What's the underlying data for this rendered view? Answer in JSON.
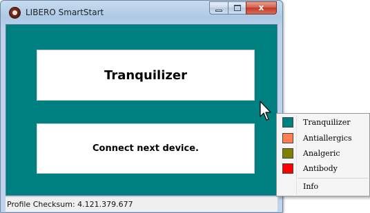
{
  "window": {
    "title": "LIBERO SmartStart",
    "icon": "libero-app-icon",
    "controls": {
      "minimize_icon": "minimize-icon",
      "maximize_icon": "maximize-icon",
      "close_glyph": "x"
    }
  },
  "main": {
    "background_color": "#007f80",
    "panel_top": "Tranquilizer",
    "panel_bottom": "Connect next device."
  },
  "status_bar": {
    "text": "Profile Checksum: 4.121.379.677"
  },
  "context_menu": {
    "items": [
      {
        "label": "Tranquilizer",
        "color": "#007f80"
      },
      {
        "label": "Antiallergics",
        "color": "#ff7f50"
      },
      {
        "label": "Analgeric",
        "color": "#808000"
      },
      {
        "label": "Antibody",
        "color": "#ff0000"
      }
    ],
    "info_label": "Info"
  }
}
